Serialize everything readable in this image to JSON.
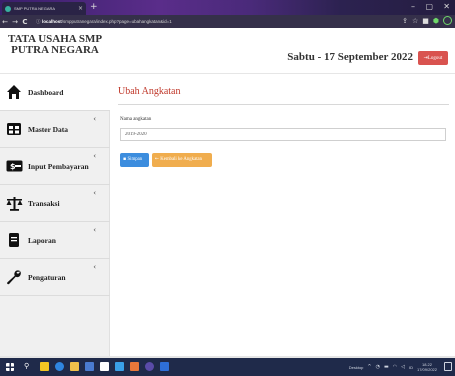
{
  "browser": {
    "tab_title": "SMP PUTRA NEGARA",
    "tab_close": "×",
    "new_tab": "+",
    "back": "←",
    "forward": "→",
    "reload": "C",
    "url_host": "localhost",
    "url_path": "/smpputranegara/index.php?page=ubahangkatan&id=1",
    "min": "–",
    "max": "▢",
    "close": "✕",
    "colors": {
      "tabbar": "#3a1f6b",
      "addrbar": "#35304a"
    }
  },
  "header": {
    "brand_line1": "TATA USAHA SMP",
    "brand_line2": "PUTRA NEGARA",
    "date": "Sabtu - 17 September 2022",
    "logout_label": "Logout",
    "logout_color": "#d9534f"
  },
  "sidebar": {
    "items": [
      {
        "label": "Dashboard",
        "icon": "home-icon",
        "chevron": "",
        "active": true
      },
      {
        "label": "Master Data",
        "icon": "table-icon",
        "chevron": "‹",
        "active": false
      },
      {
        "label": "Input Pembayaran",
        "icon": "money-icon",
        "chevron": "‹",
        "active": false
      },
      {
        "label": "Transaksi",
        "icon": "scale-icon",
        "chevron": "‹",
        "active": false
      },
      {
        "label": "Laporan",
        "icon": "file-icon",
        "chevron": "‹",
        "active": false
      },
      {
        "label": "Pengaturan",
        "icon": "wrench-icon",
        "chevron": "‹",
        "active": false
      }
    ]
  },
  "main": {
    "title": "Ubah Angkatan",
    "title_color": "#c0392b",
    "field_label": "Nama angkatan",
    "field_value": "2019-2020",
    "save_label": "Simpan",
    "back_label": "Kembali ke Angkatan",
    "save_color": "#3c8dde",
    "back_color": "#f0ad4e"
  },
  "taskbar": {
    "tray_desktop": "Desktop",
    "time": "18.22",
    "date": "17/09/2022",
    "color": "#1f2a4a"
  }
}
